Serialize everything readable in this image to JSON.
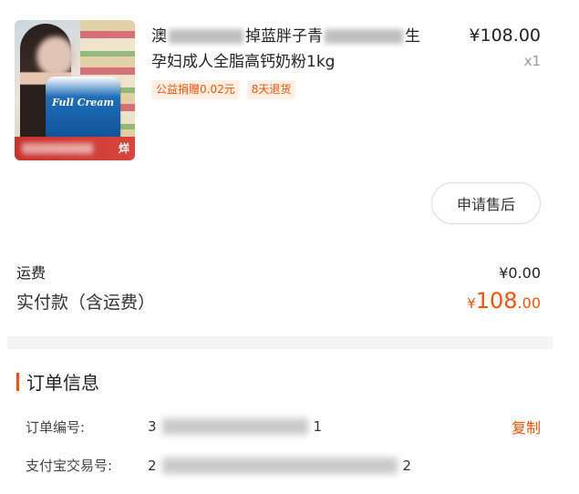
{
  "product": {
    "title_line1_start": "澳",
    "title_line1_mid": "掉蓝胖子青",
    "title_line1_end": "生",
    "title_line2": "孕妇成人全脂高钙奶粉1kg",
    "price": "¥108.00",
    "quantity": "x1",
    "tags": [
      "公益捐赠0.02元",
      "8天退货"
    ],
    "thumbnail": {
      "can_label": "Full Cream",
      "corner_text": "烊"
    }
  },
  "actions": {
    "after_sales_label": "申请售后",
    "copy_label": "复制"
  },
  "fees": {
    "shipping_label": "运费",
    "shipping_value": "¥0.00",
    "total_label": "实付款（含运费）",
    "total_currency": "¥",
    "total_int": "108",
    "total_dec": ".00"
  },
  "order_info": {
    "section_title": "订单信息",
    "order_no_label": "订单编号:",
    "order_no_prefix": "3",
    "order_no_suffix": "1",
    "alipay_label": "支付宝交易号:",
    "alipay_prefix": "2",
    "alipay_suffix": "2"
  },
  "colors": {
    "accent": "#ff5000",
    "tag_bg": "#fff0e6",
    "divider": "#f4f4f4"
  },
  "icons": {
    "section_marker": "accent-bar"
  }
}
